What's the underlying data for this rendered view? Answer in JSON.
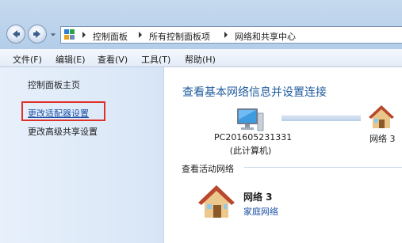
{
  "address_bar": {
    "breadcrumbs": [
      "控制面板",
      "所有控制面板项",
      "网络和共享中心"
    ]
  },
  "menu": {
    "items": [
      "文件(F)",
      "编辑(E)",
      "查看(V)",
      "工具(T)",
      "帮助(H)"
    ]
  },
  "left_pane": {
    "home_link": "控制面板主页",
    "adapter_settings_link": "更改适配器设置",
    "advanced_sharing_link": "更改高级共享设置"
  },
  "main": {
    "heading": "查看基本网络信息并设置连接",
    "computer_name": "PC201605231331",
    "computer_sub": "(此计算机)",
    "network_top_label": "网络 3",
    "active_networks_title": "查看活动网络",
    "active_network": {
      "name": "网络 3",
      "type": "家庭网络"
    }
  },
  "colors": {
    "heading": "#1f5b9e",
    "link": "#1c4fa4",
    "highlight_box": "#e0302a"
  },
  "icons": [
    "back-arrow-icon",
    "forward-arrow-icon",
    "control-panel-icon",
    "computer-icon",
    "home-network-icon"
  ]
}
